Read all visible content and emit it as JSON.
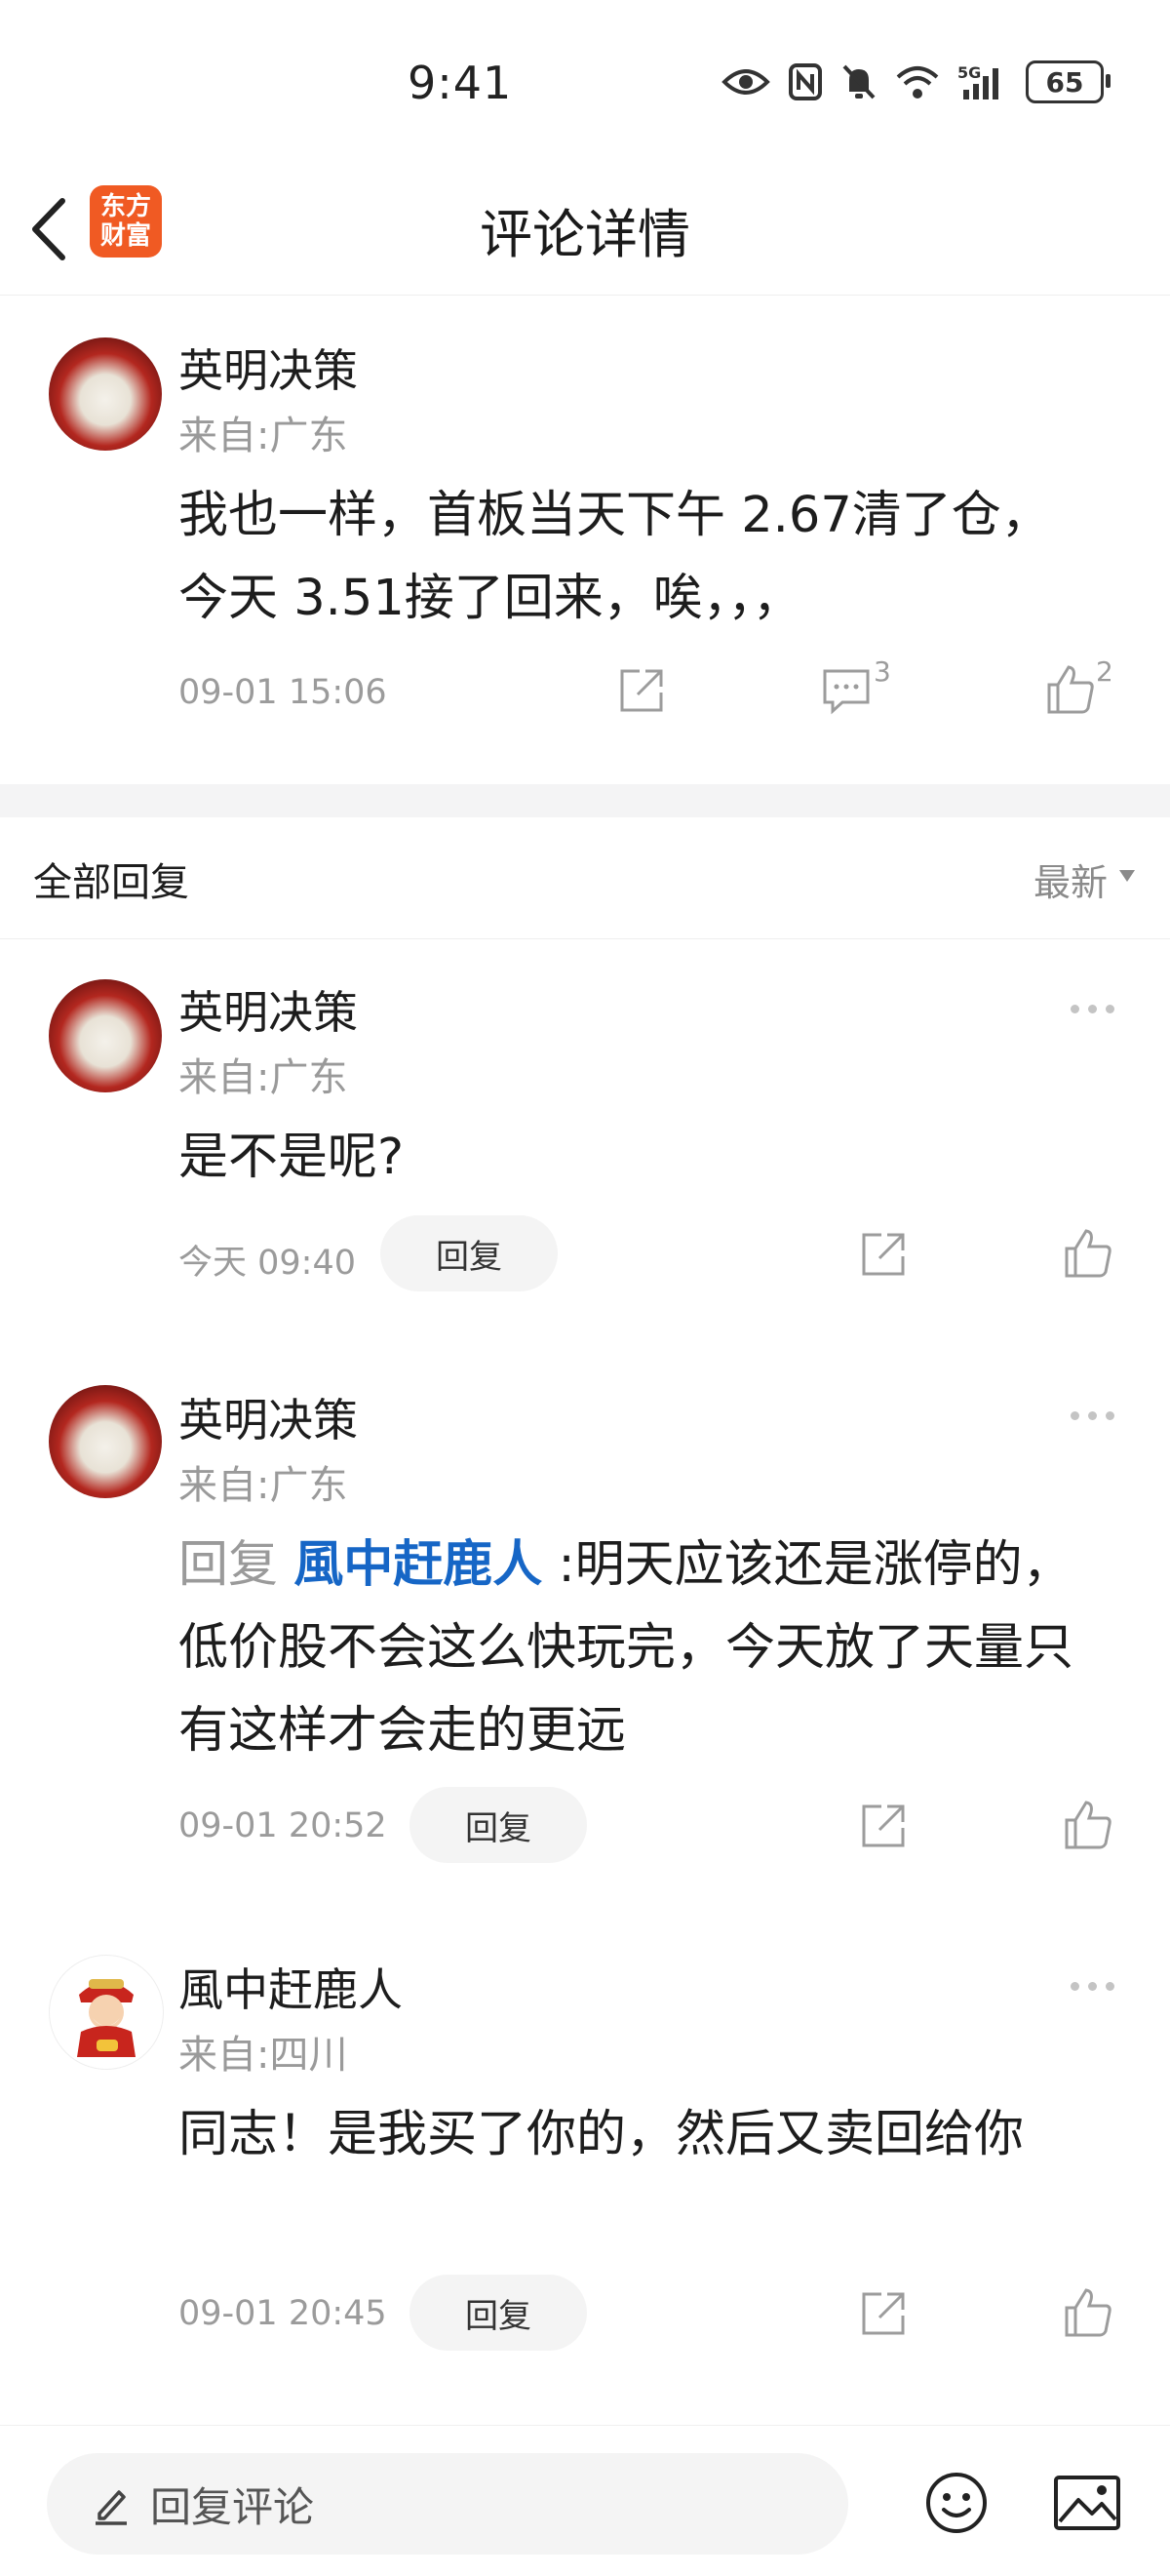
{
  "status_bar": {
    "time": "9:41",
    "battery": "65"
  },
  "header": {
    "title": "评论详情",
    "logo_line1": "东方",
    "logo_line2": "财富"
  },
  "main_comment": {
    "name": "英明决策",
    "location": "来自:广东",
    "text": "我也一样，首板当天下午 2.67清了仓，今天 3.51接了回来，唉，，，",
    "time": "09-01 15:06",
    "comment_count": "3",
    "like_count": "2"
  },
  "replies_section": {
    "title": "全部回复",
    "sort_label": "最新"
  },
  "replies": [
    {
      "name": "英明决策",
      "location": "来自:广东",
      "text": "是不是呢?",
      "time": "今天 09:40",
      "reply_label": "回复"
    },
    {
      "name": "英明决策",
      "location": "来自:广东",
      "reply_prefix": "回复",
      "reply_target": "風中赶鹿人",
      "text": ":明天应该还是涨停的，低价股不会这么快玩完，今天放了天量只有这样才会走的更远",
      "time": "09-01 20:52",
      "reply_label": "回复"
    },
    {
      "name": "風中赶鹿人",
      "location": "来自:四川",
      "text": "同志！是我买了你的，然后又卖回给你",
      "time": "09-01 20:45",
      "reply_label": "回复"
    }
  ],
  "bottom_bar": {
    "input_placeholder": "回复评论"
  },
  "colors": {
    "brand": "#f05a23",
    "link": "#1666c6",
    "muted": "#9a9a9a"
  },
  "icons": [
    "back-icon",
    "eye-icon",
    "nfc-icon",
    "mute-icon",
    "wifi-icon",
    "signal-icon",
    "share-icon",
    "comment-icon",
    "like-icon",
    "more-icon",
    "pencil-icon",
    "emoji-icon",
    "image-icon",
    "caret-down-icon"
  ]
}
